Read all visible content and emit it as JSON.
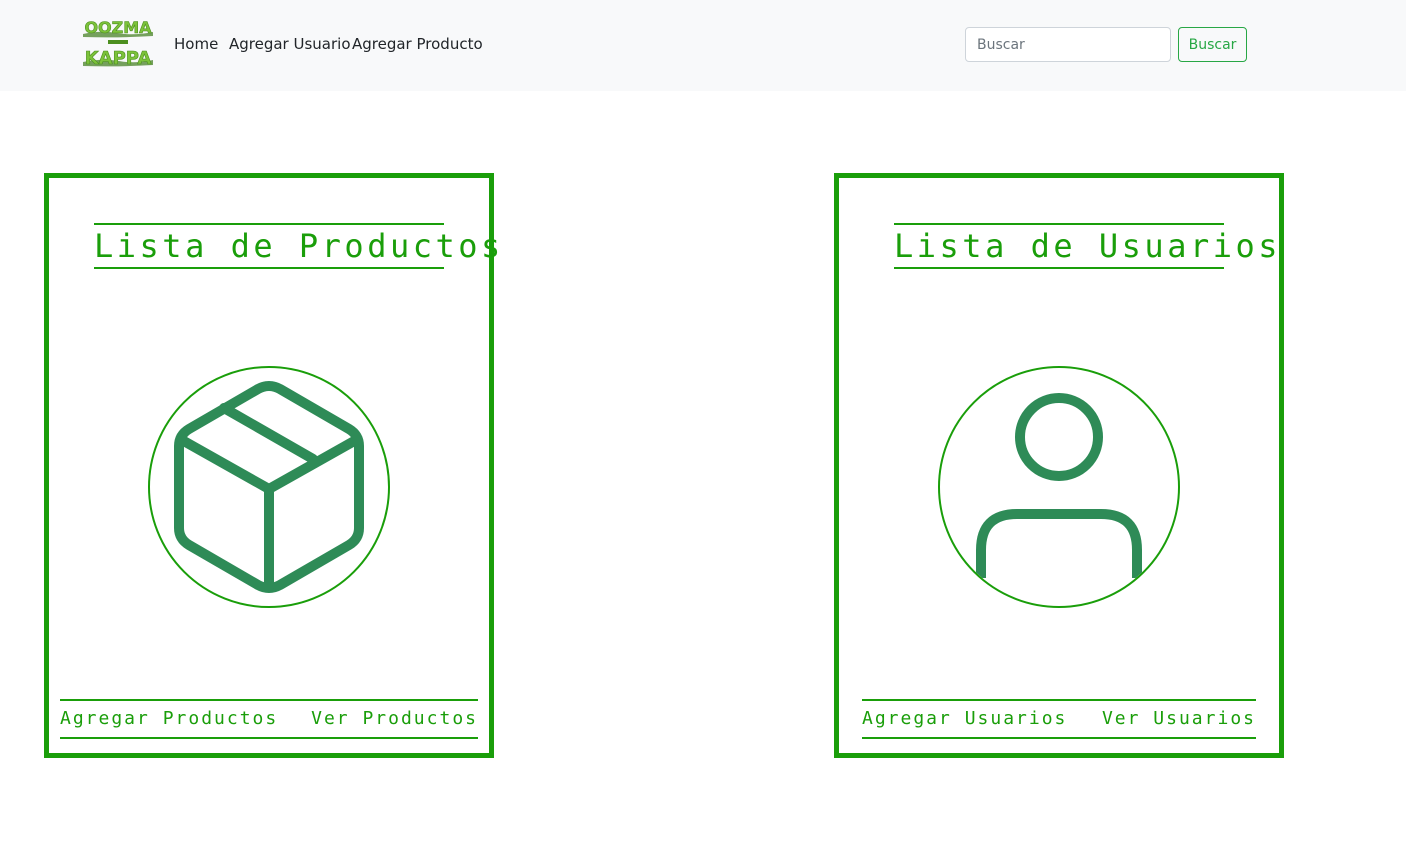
{
  "navbar": {
    "logo_text_top": "OOZMA",
    "logo_text_bottom": "KAPPA",
    "links": [
      {
        "label": "Home"
      },
      {
        "label": "Agregar Usuario"
      },
      {
        "label": "Agregar Producto"
      }
    ],
    "search": {
      "placeholder": "Buscar",
      "value": "",
      "button_label": "Buscar"
    }
  },
  "cards": {
    "products": {
      "title": "Lista de Productos",
      "icon": "box-icon",
      "footer_left": "Agregar Productos",
      "footer_right": "Ver Productos"
    },
    "users": {
      "title": "Lista de Usuarios",
      "icon": "user-icon",
      "footer_left": "Agregar Usuarios",
      "footer_right": "Ver Usuarios"
    }
  },
  "colors": {
    "accent": "#1a9e0a",
    "icon": "#2e8b57",
    "navbar_bg": "#f8f9fa",
    "button_outline": "#28a745"
  }
}
